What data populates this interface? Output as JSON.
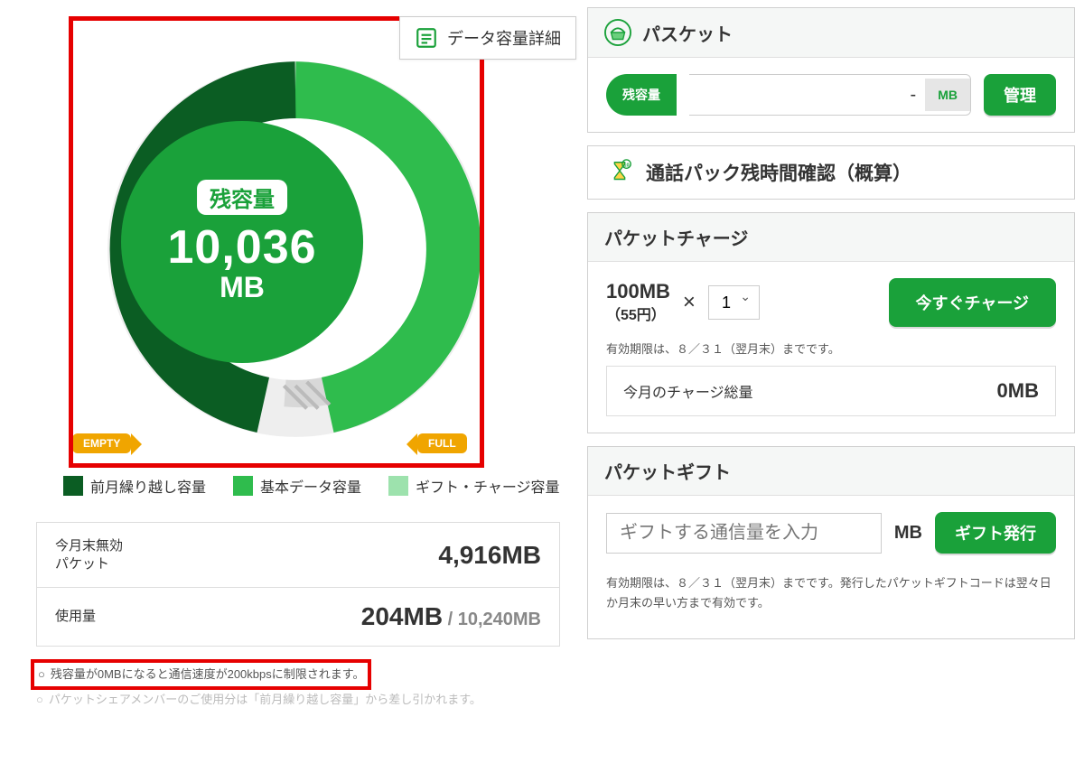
{
  "detail_button": "データ容量詳細",
  "gauge": {
    "label": "残容量",
    "value": "10,036",
    "unit": "MB",
    "empty": "EMPTY",
    "full": "FULL"
  },
  "legend": {
    "carryover": {
      "label": "前月繰り越し容量",
      "color": "#0b5d23"
    },
    "base": {
      "label": "基本データ容量",
      "color": "#2fbc4d"
    },
    "gift": {
      "label": "ギフト・チャージ容量",
      "color": "#9de2ad"
    }
  },
  "stats": {
    "expiring_label_line1": "今月末無効",
    "expiring_label_line2": "パケット",
    "expiring_value": "4,916MB",
    "usage_label": "使用量",
    "usage_value": "204MB",
    "usage_total": " / 10,240MB"
  },
  "footnotes": {
    "bullet": "○",
    "note1": "残容量が0MBになると通信速度が200kbpsに制限されます。",
    "note2": "パケットシェアメンバーのご使用分は「前月繰り越し容量」から差し引かれます。"
  },
  "pasuketto": {
    "title": "パスケット",
    "field_label": "残容量",
    "value": "-",
    "unit": "MB",
    "manage_btn": "管理"
  },
  "call_pack": "通話パック残時間確認（概算）",
  "charge": {
    "title": "パケットチャージ",
    "unit_amount": "100MB",
    "unit_price": "（55円）",
    "mult": "×",
    "qty": "1",
    "button": "今すぐチャージ",
    "expiry_note": "有効期限は、８／３１（翌月末）までです。",
    "month_label": "今月のチャージ総量",
    "month_value": "0MB"
  },
  "gift": {
    "title": "パケットギフト",
    "placeholder": "ギフトする通信量を入力",
    "unit": "MB",
    "button": "ギフト発行",
    "note": "有効期限は、８／３１（翌月末）までです。発行したパケットギフトコードは翌々日か月末の早い方まで有効です。"
  },
  "chart_data": {
    "type": "pie",
    "title": "残容量",
    "value_label": "10,036 MB",
    "series": [
      {
        "name": "前月繰り越し容量",
        "value": 4916,
        "color": "#0b5d23"
      },
      {
        "name": "基本データ容量",
        "value": 5120,
        "color": "#2fbc4d"
      },
      {
        "name": "ギフト・チャージ容量",
        "value": 0,
        "color": "#9de2ad"
      },
      {
        "name": "使用量",
        "value": 204,
        "color": "#dddddd"
      }
    ],
    "total": 10240,
    "start_angle_deg": -90,
    "direction": "counterclockwise"
  }
}
